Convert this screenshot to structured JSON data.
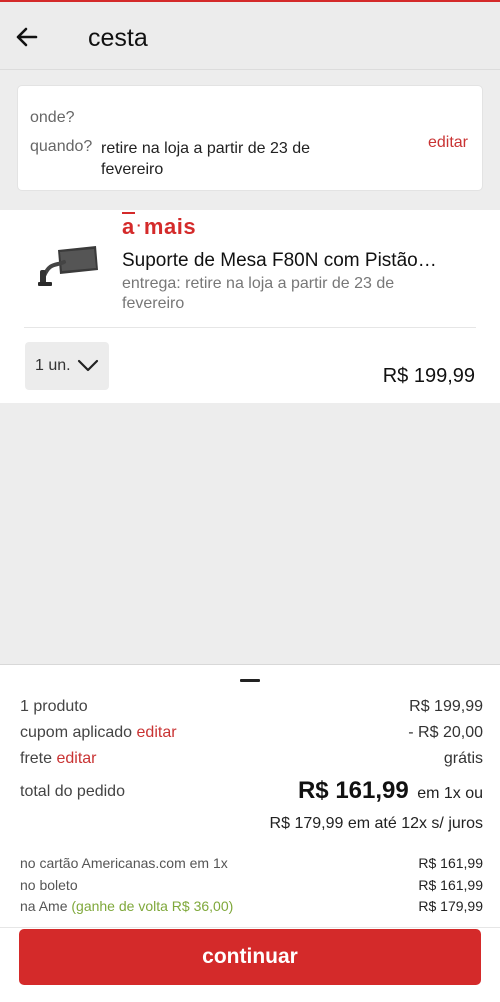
{
  "header": {
    "title": "cesta",
    "back_icon": "arrow-left-icon"
  },
  "pickup": {
    "where_label": "onde?",
    "when_label": "quando?",
    "when_value": "retire na loja a partir de 23 de fevereiro",
    "edit_label": "editar"
  },
  "product": {
    "brand_a": "a",
    "brand_dot": "·",
    "brand_mais": "mais",
    "name": "Suporte de Mesa F80N com Pistão…",
    "delivery": "entrega: retire na loja a partir de 23 de fevereiro",
    "quantity": "1 un.",
    "price": "R$ 199,99",
    "thumb_icon": "monitor-arm-icon"
  },
  "summary": {
    "products_label": "1 produto",
    "products_value": "R$ 199,99",
    "coupon_label": "cupom aplicado",
    "coupon_edit": "editar",
    "coupon_value": "- R$ 20,00",
    "shipping_label": "frete",
    "shipping_edit": "editar",
    "shipping_value": "grátis",
    "total_label": "total do pedido",
    "total_value": "R$ 161,99",
    "total_suffix": "em 1x ou",
    "installments": "R$ 179,99 em até 12x s/ juros",
    "pay_card_label": "no cartão Americanas.com em 1x",
    "pay_card_value": "R$ 161,99",
    "pay_boleto_label": "no boleto",
    "pay_boleto_value": "R$ 161,99",
    "pay_ame_label": "na Ame",
    "pay_ame_cashback": "(ganhe de volta R$ 36,00)",
    "pay_ame_value": "R$ 179,99"
  },
  "continue_label": "continuar",
  "colors": {
    "brand_red": "#d42a2a",
    "green": "#7fa83b"
  }
}
